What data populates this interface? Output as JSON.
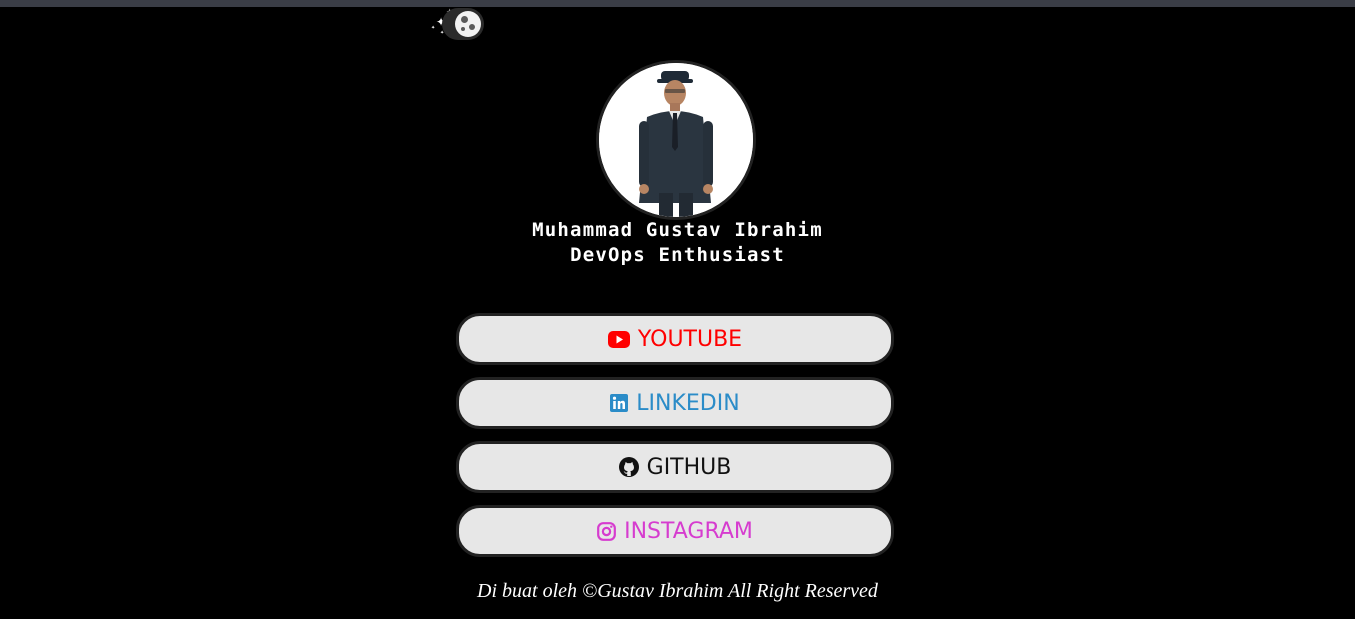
{
  "profile": {
    "name": "Muhammad Gustav Ibrahim",
    "role": "DevOps Enthusiast"
  },
  "links": {
    "youtube": {
      "label": "YOUTUBE",
      "icon": "youtube-icon",
      "color": "#ff0000"
    },
    "linkedin": {
      "label": "LINKEDIN",
      "icon": "linkedin-icon",
      "color": "#2b8cc8"
    },
    "github": {
      "label": "GITHUB",
      "icon": "github-icon",
      "color": "#111111"
    },
    "instagram": {
      "label": "INSTAGRAM",
      "icon": "instagram-icon",
      "color": "#d63ccf"
    }
  },
  "footer": {
    "text": "Di buat oleh ©Gustav Ibrahim All Right Reserved"
  },
  "theme_toggle": {
    "icon": "moon-icon",
    "state": "dark"
  },
  "colors": {
    "background": "#000000",
    "button_background": "#e7e7e7",
    "text": "#ffffff"
  }
}
